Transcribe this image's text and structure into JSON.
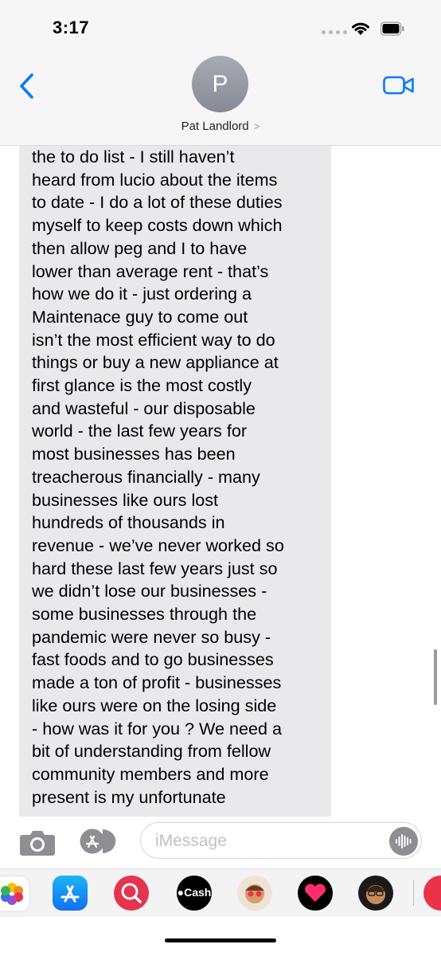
{
  "status_bar": {
    "time": "3:17"
  },
  "header": {
    "avatar_initial": "P",
    "contact_name": "Pat Landlord",
    "contact_chevron": ">"
  },
  "message": {
    "text": "the to do list - I still haven’t\nheard from lucio about the items\nto date - I do a lot of these duties\nmyself to keep costs down which\nthen allow peg and I to have\nlower than average rent - that’s\nhow we do it - just ordering a\nMaintenace guy to come out\nisn’t the most efficient way to do\nthings or buy a new appliance at\nfirst glance is the most costly\nand wasteful - our disposable\nworld - the last few years for\nmost businesses has been\ntreacherous financially - many\nbusinesses like ours lost\nhundreds of thousands in\nrevenue - we’ve never worked so\nhard these last few years just so\nwe didn’t lose our businesses -\nsome businesses through the\npandemic were never so busy  -\nfast foods and to go businesses\nmade a ton of profit - businesses\nlike ours were on the losing side\n- how was it for you ?  We need a\nbit of understanding from fellow\ncommunity members and more\npresent is my unfortunate"
  },
  "compose": {
    "placeholder": "iMessage"
  },
  "drawer": {
    "cash_label": "Cash"
  },
  "colors": {
    "accent": "#0a7aff",
    "bubble": "#e9e9eb"
  }
}
